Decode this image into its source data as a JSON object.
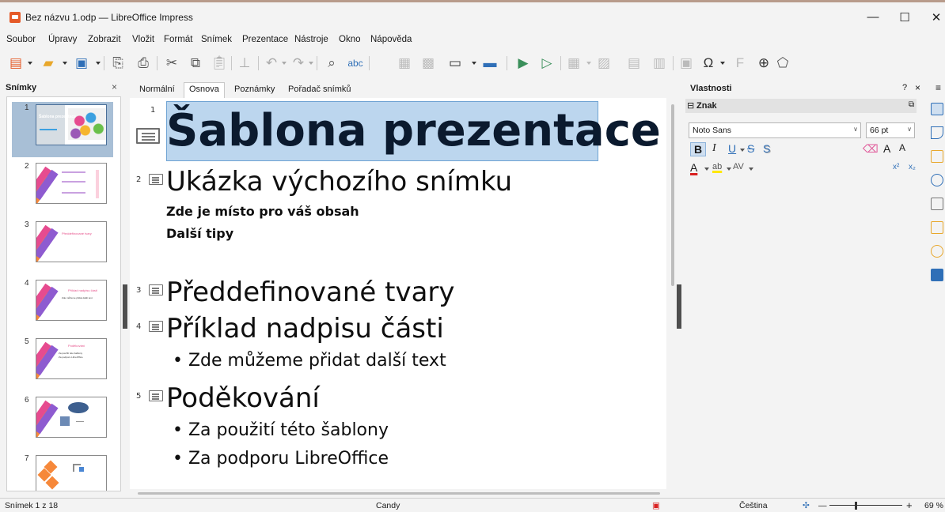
{
  "window": {
    "title": "Bez názvu 1.odp — LibreOffice Impress",
    "minimize": "—",
    "maximize": "☐",
    "close": "✕"
  },
  "menu": [
    "Soubor",
    "Úpravy",
    "Zobrazit",
    "Vložit",
    "Formát",
    "Snímek",
    "Prezentace",
    "Nástroje",
    "Okno",
    "Nápověda"
  ],
  "slides_panel": {
    "title": "Snímky",
    "close": "×",
    "thumbnails": [
      {
        "num": "1",
        "title": "Šablona prezentace",
        "selected": true
      },
      {
        "num": "2",
        "title": "Ukázka výchozího snímku",
        "selected": false
      },
      {
        "num": "3",
        "title": "Předdefinované tvary",
        "selected": false
      },
      {
        "num": "4",
        "title": "Příklad nadpisu části",
        "text": "Zde můžeme přidat další text",
        "selected": false
      },
      {
        "num": "5",
        "title": "Poděkování",
        "text": "Za použití této šablony Za podporu LibreOffice",
        "selected": false
      },
      {
        "num": "6",
        "title": "",
        "selected": false
      },
      {
        "num": "7",
        "title": "",
        "selected": false
      }
    ]
  },
  "view_tabs": [
    "Normální",
    "Osnova",
    "Poznámky",
    "Pořadač snímků"
  ],
  "active_tab": "Osnova",
  "outline": {
    "s1": {
      "num": "1",
      "title": "Šablona prezentace"
    },
    "s2": {
      "num": "2",
      "title": "Ukázka výchozího snímku",
      "items": [
        "Zde je místo pro váš obsah",
        "Další tipy"
      ]
    },
    "s3": {
      "num": "3",
      "title": "Předdefinované tvary"
    },
    "s4": {
      "num": "4",
      "title": "Příklad nadpisu části",
      "items": [
        "Zde můžeme přidat další text"
      ]
    },
    "s5": {
      "num": "5",
      "title": "Poděkování",
      "items": [
        "Za použití této šablony",
        "Za podporu LibreOffice"
      ]
    },
    "bullet": "•"
  },
  "properties": {
    "title": "Vlastnosti",
    "help": "?",
    "close": "×",
    "menu": "≡",
    "section": "Znak",
    "section_toggle": "⊟",
    "font_name": "Noto Sans",
    "font_size": "66 pt",
    "bold": "B",
    "italic": "I",
    "underline": "U",
    "strike": "S",
    "shadow": "S",
    "font_color": "A",
    "highlight": "ab",
    "spacing": "AV",
    "grow": "A",
    "shrink": "A",
    "superscript": "x²",
    "subscript": "x₂"
  },
  "status": {
    "slide": "Snímek 1 z 18",
    "master": "Candy",
    "language": "Čeština",
    "zoom_minus": "—",
    "zoom_plus": "+",
    "zoom": "69 %"
  },
  "colors": {
    "accent": "#2f6fb7",
    "selection": "#bcd6ee",
    "thumb_selected": "#a8bfd6"
  }
}
